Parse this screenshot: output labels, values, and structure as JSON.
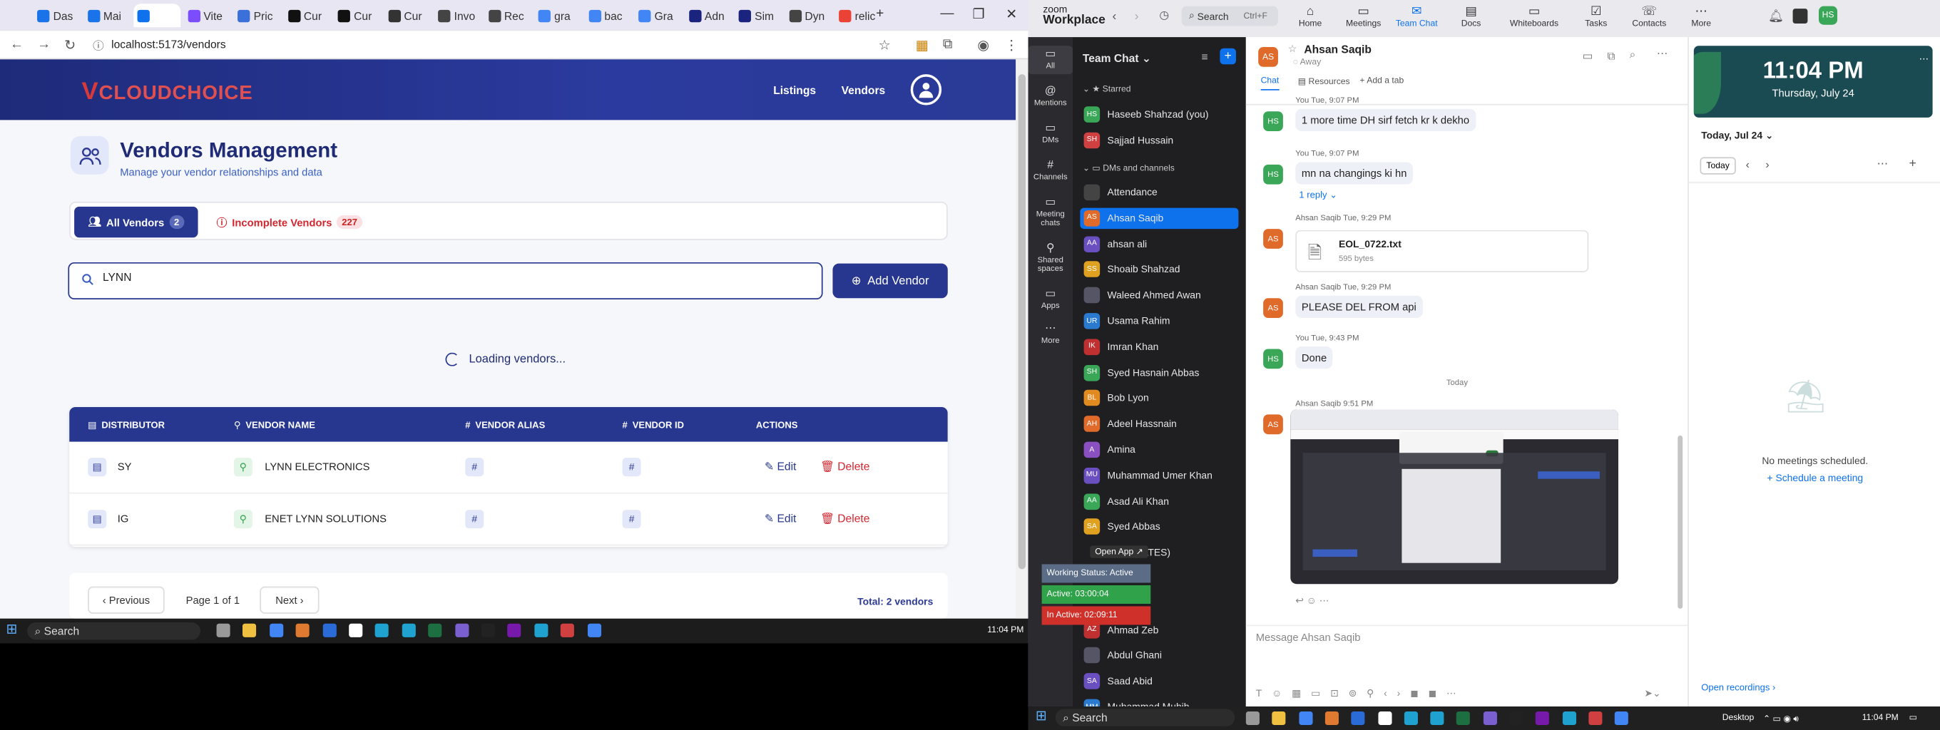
{
  "browser": {
    "tabs": [
      "Das",
      "Mai",
      "",
      "Vite",
      "Pric",
      "Cur",
      "Cur",
      "Cur",
      "Invo",
      "Rec",
      "gra",
      "bac",
      "Gra",
      "Adn",
      "Sim",
      "Dyn",
      "relic"
    ],
    "url": "localhost:5173/vendors"
  },
  "app": {
    "logo": "CLOUDCHOICE",
    "nav": {
      "listings": "Listings",
      "vendors": "Vendors"
    },
    "title": "Vendors Management",
    "subtitle": "Manage your vendor relationships and data",
    "tabs": {
      "all_label": "All Vendors",
      "all_count": "2",
      "incomplete_label": "Incomplete Vendors",
      "incomplete_count": "227"
    },
    "search_value": "LYNN",
    "add_vendor": "Add Vendor",
    "loading": "Loading vendors...",
    "columns": [
      "DISTRIBUTOR",
      "VENDOR NAME",
      "VENDOR ALIAS",
      "VENDOR ID",
      "ACTIONS"
    ],
    "rows": [
      {
        "distributor": "SY",
        "vendor": "LYNN ELECTRONICS",
        "alias": "#",
        "id": "#"
      },
      {
        "distributor": "IG",
        "vendor": "ENET LYNN SOLUTIONS",
        "alias": "#",
        "id": "#"
      }
    ],
    "edit": "Edit",
    "delete": "Delete",
    "pager": {
      "prev": "Previous",
      "page": "Page 1 of 1",
      "next": "Next",
      "total": "Total: 2 vendors"
    }
  },
  "taskbar": {
    "search": "Search",
    "time_left": "11:04 PM",
    "time_right": "11:04 PM",
    "desktop": "Desktop"
  },
  "zoom": {
    "logo_top": "zoom",
    "logo": "Workplace",
    "search": "Search",
    "search_shortcut": "Ctrl+F",
    "tabs": [
      "Home",
      "Meetings",
      "Team Chat",
      "Docs",
      "Whiteboards",
      "Tasks",
      "Contacts",
      "More"
    ],
    "sidebar": [
      "All",
      "Mentions",
      "DMs",
      "Channels",
      "Meeting chats",
      "Shared spaces",
      "Apps",
      "More"
    ],
    "chan_title": "Team Chat",
    "starred": "Starred",
    "dms": "DMs and channels",
    "contacts": [
      {
        "init": "HS",
        "name": "Haseeb Shahzad (you)",
        "color": "#3aa657"
      },
      {
        "init": "SH",
        "name": "Sajjad Hussain",
        "color": "#d04040"
      }
    ],
    "channels": [
      {
        "init": "",
        "name": "Attendance",
        "color": "#444"
      },
      {
        "init": "AS",
        "name": "Ahsan Saqib",
        "color": "#e06a2a"
      },
      {
        "init": "AA",
        "name": "ahsan ali",
        "color": "#6a4fc0"
      },
      {
        "init": "SS",
        "name": "Shoaib Shahzad",
        "color": "#e0a020"
      },
      {
        "init": "",
        "name": "Waleed Ahmed Awan",
        "color": "#556"
      },
      {
        "init": "UR",
        "name": "Usama Rahim",
        "color": "#2a7ad0"
      },
      {
        "init": "IK",
        "name": "Imran Khan",
        "color": "#c03030"
      },
      {
        "init": "SH",
        "name": "Syed Hasnain Abbas",
        "color": "#3aa657"
      },
      {
        "init": "BL",
        "name": "Bob Lyon",
        "color": "#e08a20"
      },
      {
        "init": "AH",
        "name": "Adeel Hassnain",
        "color": "#e06a2a"
      },
      {
        "init": "A",
        "name": "Amina",
        "color": "#8a4fc0"
      },
      {
        "init": "MU",
        "name": "Muhammad Umer Khan",
        "color": "#6a4fc0"
      },
      {
        "init": "AA",
        "name": "Asad Ali Khan",
        "color": "#3aa657"
      },
      {
        "init": "SA",
        "name": "Syed Abbas",
        "color": "#e0a020"
      },
      {
        "init": "",
        "name": "al (UPDATES)",
        "color": "#1f1f22"
      },
      {
        "init": "",
        "name": "",
        "color": "#1f1f22"
      },
      {
        "init": "",
        "name": "",
        "color": "#1f1f22"
      },
      {
        "init": "AZ",
        "name": "Ahmad Zeb",
        "color": "#c03030"
      },
      {
        "init": "",
        "name": "Abdul Ghani",
        "color": "#556"
      },
      {
        "init": "SA",
        "name": "Saad Abid",
        "color": "#6a4fc0"
      },
      {
        "init": "MM",
        "name": "Muhammad Muhib",
        "color": "#2a7ad0"
      }
    ],
    "chat_name": "Ahsan Saqib",
    "chat_status": "Away",
    "chat_tab": "Chat",
    "resources": "Resources",
    "add_tab": "Add a tab",
    "messages": [
      {
        "init": "HS",
        "meta": "You Tue, 9:07 PM",
        "text": "1 more time DH sirf fetch kr k dekho"
      },
      {
        "init": "HS",
        "meta": "You Tue, 9:07 PM",
        "text": "mn na changings ki hn"
      },
      {
        "init": "AS",
        "meta": "Ahsan Saqib Tue, 9:29 PM",
        "text": ""
      },
      {
        "init": "AS",
        "meta": "Ahsan Saqib Tue, 9:29 PM",
        "text": "PLEASE DEL FROM api"
      },
      {
        "init": "HS",
        "meta": "You Tue, 9:43 PM",
        "text": "Done"
      },
      {
        "init": "AS",
        "meta": "Ahsan Saqib 9:51 PM",
        "text": ""
      }
    ],
    "reply": "1 reply",
    "file_name": "EOL_0722.txt",
    "file_size": "595 bytes",
    "today": "Today",
    "compose": "Message Ahsan Saqib",
    "clock_time": "11:04 PM",
    "clock_date": "Thursday, July 24",
    "cal_date": "Today, Jul 24",
    "cal_today": "Today",
    "no_meetings": "No meetings scheduled.",
    "schedule": "Schedule a meeting",
    "open_recordings": "Open recordings",
    "open_app": "Open App"
  },
  "overlay": {
    "status": "Working Status: Active",
    "active": "Active: 03:00:04",
    "inactive": "In Active: 02:09:11"
  },
  "colors": {
    "brand": "#27378f",
    "danger": "#d3262f",
    "zoom_blue": "#0e72ed"
  }
}
